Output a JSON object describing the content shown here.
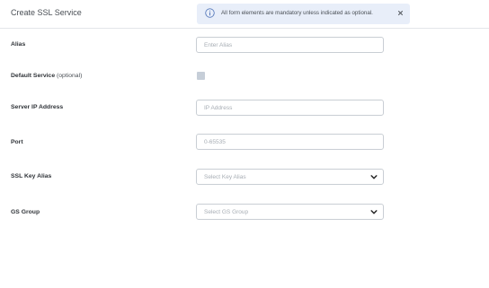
{
  "header": {
    "title": "Create SSL Service"
  },
  "banner": {
    "message": "All form elements are mandatory unless indicated as optional."
  },
  "form": {
    "alias": {
      "label": "Alias",
      "placeholder": "Enter Alias"
    },
    "default_service": {
      "label": "Default Service",
      "optional_label": "(optional)",
      "checked": false
    },
    "server_ip": {
      "label": "Server IP Address",
      "placeholder": "IP Address"
    },
    "port": {
      "label": "Port",
      "placeholder": "0-65535"
    },
    "ssl_key_alias": {
      "label": "SSL Key Alias",
      "selected": "Select Key Alias"
    },
    "gs_group": {
      "label": "GS Group",
      "selected": "Select GS Group"
    }
  },
  "colors": {
    "banner_bg": "#e8eef9",
    "checkbox_bg": "#c6ced8",
    "field_border": "#c9ced4"
  }
}
